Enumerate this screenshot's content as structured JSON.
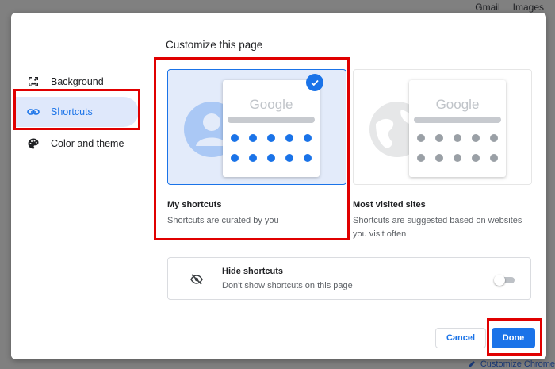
{
  "background_page": {
    "top_links": [
      "Gmail",
      "Images"
    ],
    "customize_label": "Customize Chrome"
  },
  "dialog": {
    "title": "Customize this page",
    "sidebar": {
      "items": [
        {
          "label": "Background",
          "icon": "background-image-icon",
          "active": false
        },
        {
          "label": "Shortcuts",
          "icon": "link-icon",
          "active": true
        },
        {
          "label": "Color and theme",
          "icon": "palette-icon",
          "active": false
        }
      ]
    },
    "options": [
      {
        "label": "My shortcuts",
        "description": "Shortcuts are curated by you",
        "selected": true,
        "preview_logo": "Google"
      },
      {
        "label": "Most visited sites",
        "description_line1": "Shortcuts are suggested based on websites",
        "description_line2": "you visit often",
        "selected": false,
        "preview_logo": "Google"
      }
    ],
    "hide_shortcuts": {
      "title": "Hide shortcuts",
      "description": "Don't show shortcuts on this page",
      "enabled": false
    },
    "buttons": {
      "cancel": "Cancel",
      "done": "Done"
    }
  },
  "colors": {
    "accent": "#1a73e8",
    "selected_bg": "#e3ebfa",
    "annotation": "#e00000"
  }
}
